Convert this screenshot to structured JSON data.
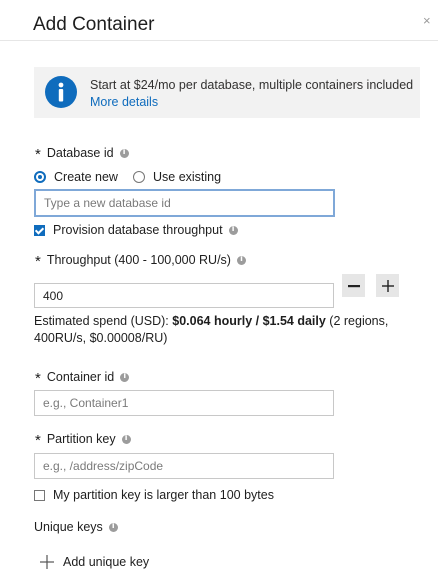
{
  "dialog": {
    "title": "Add Container",
    "close_glyph": "×"
  },
  "info": {
    "message": "Start at $24/mo per database, multiple containers included",
    "link": "More details"
  },
  "database": {
    "label": "Database id",
    "options": [
      "Create new",
      "Use existing"
    ],
    "selected": "Create new",
    "placeholder": "Type a new database id",
    "provision_label": "Provision database throughput",
    "provision_checked": true
  },
  "throughput": {
    "label": "Throughput (400 - 100,000 RU/s)",
    "value": "400",
    "spend_prefix": "Estimated spend (USD): ",
    "spend_bold": "$0.064 hourly / $1.54 daily",
    "spend_suffix": " (2 regions, 400RU/s, $0.00008/RU)"
  },
  "container": {
    "label": "Container id",
    "placeholder": "e.g., Container1"
  },
  "partition": {
    "label": "Partition key",
    "placeholder": "e.g., /address/zipCode",
    "large_key_label": "My partition key is larger than 100 bytes",
    "large_key_checked": false
  },
  "unique_keys": {
    "label": "Unique keys",
    "add_label": "Add unique key"
  },
  "colors": {
    "accent": "#0f6cbd",
    "info_bg": "#f2f2f2"
  },
  "icons": [
    "close-icon",
    "info-icon",
    "help-icon",
    "minus-icon",
    "plus-icon"
  ]
}
